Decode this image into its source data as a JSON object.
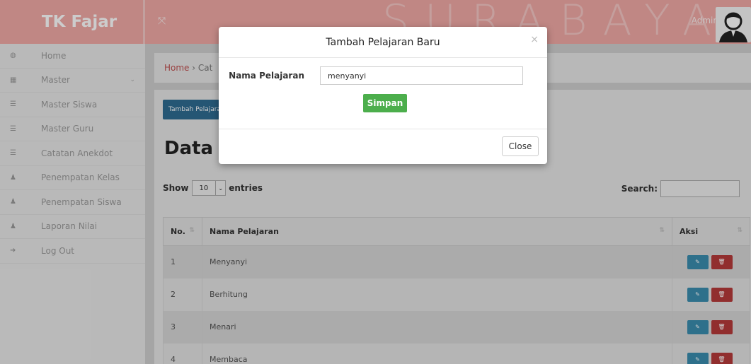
{
  "brand": "TK Fajar",
  "watermark": "SURABAYA",
  "topbar": {
    "user": "Admin"
  },
  "sidebar": {
    "items": [
      {
        "label": "Home",
        "icon": "dashboard-icon"
      },
      {
        "label": "Master",
        "icon": "table-icon",
        "has_dropdown": true
      },
      {
        "label": "Master Siswa",
        "icon": "list-icon"
      },
      {
        "label": "Master Guru",
        "icon": "list-icon"
      },
      {
        "label": "Catatan Anekdot",
        "icon": "list-icon"
      },
      {
        "label": "Penempatan Kelas",
        "icon": "user-icon"
      },
      {
        "label": "Penempatan Siswa",
        "icon": "user-icon"
      },
      {
        "label": "Laporan Nilai",
        "icon": "user-icon"
      },
      {
        "label": "Log Out",
        "icon": "sign-out-icon"
      }
    ]
  },
  "breadcrumb": {
    "home": "Home",
    "separator": "›",
    "current": "Cat"
  },
  "main": {
    "add_button": "Tambah Pelajaran",
    "title": "Data P",
    "show_label": "Show",
    "entries_value": "10",
    "entries_label": "entries",
    "search_label": "Search:",
    "table": {
      "columns": [
        "No.",
        "Nama Pelajaran",
        "Aksi"
      ],
      "rows": [
        {
          "no": "1",
          "name": "Menyanyi"
        },
        {
          "no": "2",
          "name": "Berhitung"
        },
        {
          "no": "3",
          "name": "Menari"
        },
        {
          "no": "4",
          "name": "Membaca"
        }
      ]
    }
  },
  "modal": {
    "title": "Tambah Pelajaran Baru",
    "field_label": "Nama Pelajaran",
    "field_value": "menyanyi",
    "save_label": "Simpan",
    "close_label": "Close",
    "close_x": "×"
  },
  "colors": {
    "brand": "#f0a9a6",
    "primary": "#2f6c92",
    "success": "#4cae4c",
    "info": "#3a8cae",
    "danger": "#b63a3a"
  }
}
